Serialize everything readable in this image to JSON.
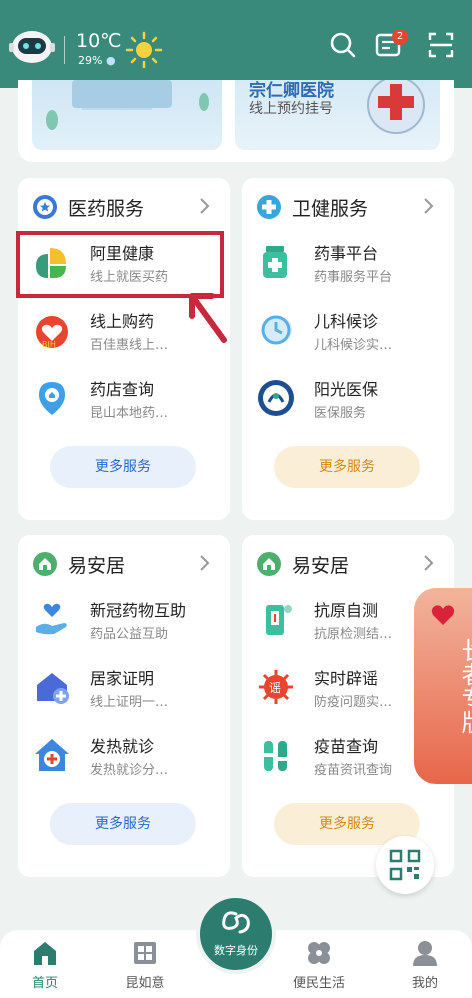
{
  "header": {
    "temperature": "10℃",
    "humidity": "29%",
    "message_badge": "2",
    "icons": [
      "robot-avatar",
      "sun-icon",
      "search-icon",
      "message-icon",
      "scan-icon"
    ]
  },
  "banner": {
    "right_title": "宗仁卿医院",
    "right_sub": "线上预约挂号"
  },
  "cards": [
    {
      "title": "医药服务",
      "icon": "star-shield-icon",
      "items": [
        {
          "title": "阿里健康",
          "sub": "线上就医买药"
        },
        {
          "title": "线上购药",
          "sub": "百佳惠线上…"
        },
        {
          "title": "药店查询",
          "sub": "昆山本地药…"
        }
      ],
      "more": "更多服务"
    },
    {
      "title": "卫健服务",
      "icon": "medical-cross-icon",
      "items": [
        {
          "title": "药事平台",
          "sub": "药事服务平台"
        },
        {
          "title": "儿科候诊",
          "sub": "儿科候诊实…"
        },
        {
          "title": "阳光医保",
          "sub": "医保服务"
        }
      ],
      "more": "更多服务"
    },
    {
      "title": "易安居",
      "icon": "home-icon",
      "items": [
        {
          "title": "新冠药物互助",
          "sub": "药品公益互助"
        },
        {
          "title": "居家证明",
          "sub": "线上证明一…"
        },
        {
          "title": "发热就诊",
          "sub": "发热就诊分…"
        }
      ],
      "more": "更多服务"
    },
    {
      "title": "易安居",
      "icon": "home-icon",
      "items": [
        {
          "title": "抗原自测",
          "sub": "抗原检测结…"
        },
        {
          "title": "实时辟谣",
          "sub": "防疫问题实…"
        },
        {
          "title": "疫苗查询",
          "sub": "疫苗资讯查询"
        }
      ],
      "more": "更多服务"
    }
  ],
  "elder_mode": "长者专版",
  "center_button": "数字身份",
  "nav": [
    {
      "label": "首页"
    },
    {
      "label": "昆如意"
    },
    {
      "label": "便民生活"
    },
    {
      "label": "我的"
    }
  ],
  "colors": {
    "header_bg": "#3a8a7c",
    "highlight": "#c8283b",
    "more_blue": "#2f67c9",
    "more_yellow": "#d28a1c"
  }
}
